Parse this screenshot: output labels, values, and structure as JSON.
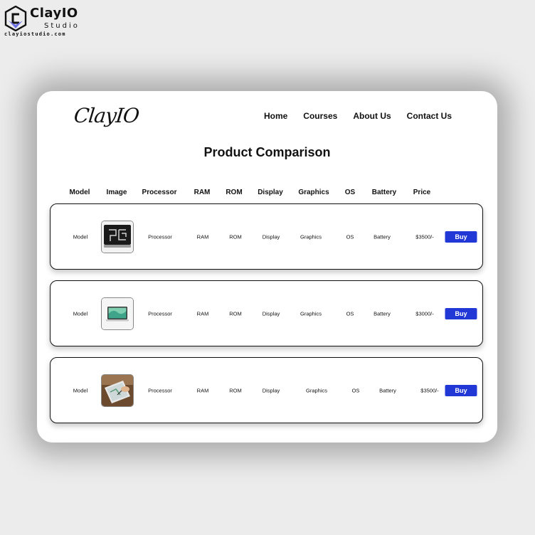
{
  "watermark": {
    "name": "ClayIO",
    "sub": "Studio",
    "url": "clayiostudio.com"
  },
  "site": {
    "logo": "ClayIO",
    "nav": [
      "Home",
      "Courses",
      "About Us",
      "Contact Us"
    ]
  },
  "page_title": "Product Comparison",
  "columns": [
    "Model",
    "Image",
    "Processor",
    "RAM",
    "ROM",
    "Display",
    "Graphics",
    "OS",
    "Battery",
    "Price"
  ],
  "rows": [
    {
      "model": "Model",
      "image": "laptop-dark-icon",
      "processor": "Processor",
      "ram": "RAM",
      "rom": "ROM",
      "display": "Display",
      "graphics": "Graphics",
      "os": "OS",
      "battery": "Battery",
      "price": "$3500/-",
      "buy_label": "Buy"
    },
    {
      "model": "Model",
      "image": "laptop-green-icon",
      "processor": "Processor",
      "ram": "RAM",
      "rom": "ROM",
      "display": "Display",
      "graphics": "Graphics",
      "os": "OS",
      "battery": "Battery",
      "price": "$3000/-",
      "buy_label": "Buy"
    },
    {
      "model": "Model",
      "image": "tablet-photo-icon",
      "processor": "Processor",
      "ram": "RAM",
      "rom": "ROM",
      "display": "Display",
      "graphics": "Graphics",
      "os": "OS",
      "battery": "Battery",
      "price": "$3500/-",
      "buy_label": "Buy"
    }
  ],
  "colors": {
    "accent": "#2238d6",
    "background": "#ececec",
    "card": "#ffffff"
  }
}
